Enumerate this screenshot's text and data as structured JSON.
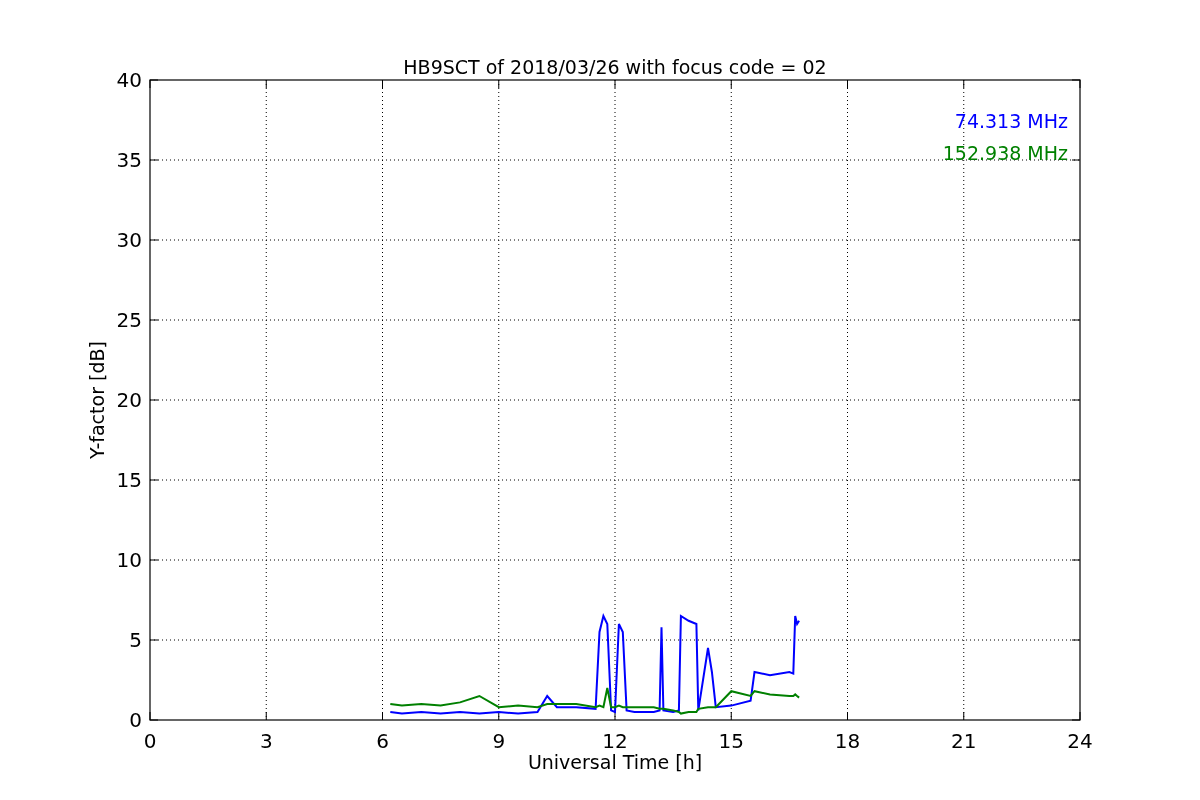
{
  "chart": {
    "chart_data": {
      "type": "line",
      "title": "HB9SCT of 2018/03/26 with focus code = 02",
      "xlabel": "Universal Time [h]",
      "ylabel": "Y-factor [dB]",
      "x": [
        6.2,
        6.5,
        7,
        7.5,
        8,
        8.5,
        9,
        9.5,
        10,
        10.25,
        10.5,
        11,
        11.5,
        11.6,
        11.7,
        11.8,
        11.9,
        12,
        12.1,
        12.2,
        12.3,
        12.5,
        13,
        13.15,
        13.2,
        13.25,
        13.5,
        13.65,
        13.7,
        13.9,
        14.1,
        14.15,
        14.4,
        14.5,
        14.6,
        15,
        15.5,
        15.6,
        16,
        16.5,
        16.6,
        16.65,
        16.7,
        16.75
      ],
      "series": [
        {
          "name": "74.313 MHz",
          "color": "#0000ff",
          "values": [
            0.5,
            0.4,
            0.5,
            0.4,
            0.5,
            0.4,
            0.5,
            0.4,
            0.5,
            1.5,
            0.8,
            0.8,
            0.7,
            5.5,
            6.5,
            6.0,
            0.6,
            0.5,
            6.0,
            5.5,
            0.6,
            0.5,
            0.5,
            0.6,
            5.8,
            0.6,
            0.5,
            0.6,
            6.5,
            6.2,
            6.0,
            0.6,
            4.5,
            3.0,
            0.8,
            0.9,
            1.2,
            3.0,
            2.8,
            3.0,
            2.9,
            6.5,
            6.0,
            6.2
          ]
        },
        {
          "name": "152.938 MHz",
          "color": "#008000",
          "values": [
            1.0,
            0.9,
            1.0,
            0.9,
            1.1,
            1.5,
            0.8,
            0.9,
            0.8,
            1.0,
            1.0,
            1.0,
            0.8,
            0.9,
            0.8,
            2.0,
            0.8,
            0.8,
            0.9,
            0.8,
            0.8,
            0.8,
            0.8,
            0.7,
            0.7,
            0.7,
            0.6,
            0.5,
            0.4,
            0.5,
            0.5,
            0.7,
            0.8,
            0.8,
            0.8,
            1.8,
            1.5,
            1.8,
            1.6,
            1.5,
            1.5,
            1.6,
            1.5,
            1.4
          ]
        }
      ],
      "xlim": [
        0,
        24
      ],
      "ylim": [
        0,
        40
      ],
      "xticks": [
        0,
        3,
        6,
        9,
        12,
        15,
        18,
        21,
        24
      ],
      "yticks": [
        0,
        5,
        10,
        15,
        20,
        25,
        30,
        35,
        40
      ],
      "grid": true
    }
  }
}
